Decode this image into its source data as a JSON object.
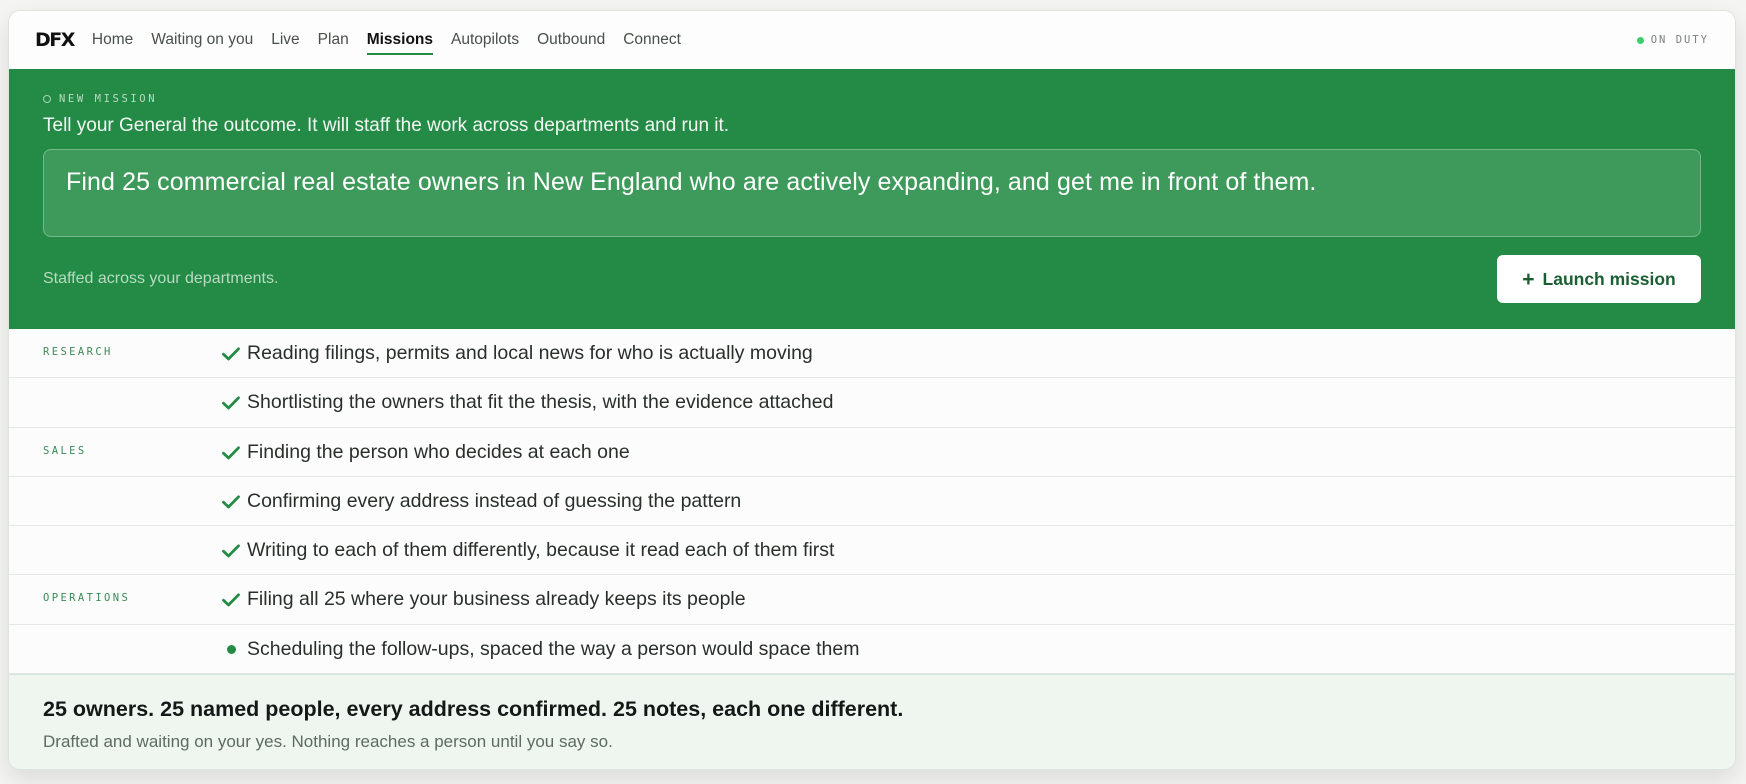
{
  "nav": {
    "logo": "DFX",
    "links": [
      "Home",
      "Waiting on you",
      "Live",
      "Plan",
      "Missions",
      "Autopilots",
      "Outbound",
      "Connect"
    ],
    "active": "Missions",
    "status": "ON DUTY"
  },
  "hero": {
    "eyebrow": "NEW MISSION",
    "subtitle": "Tell your General the outcome. It will staff the work across departments and run it.",
    "mission_text": "Find 25 commercial real estate owners in New England who are actively expanding, and get me in front of them.",
    "staffed": "Staffed across your departments.",
    "launch_label": "Launch mission"
  },
  "tasks": [
    {
      "dept": "RESEARCH",
      "text": "Reading filings, permits and local news for who is actually moving",
      "state": "done"
    },
    {
      "dept": "",
      "text": "Shortlisting the owners that fit the thesis, with the evidence attached",
      "state": "done"
    },
    {
      "dept": "SALES",
      "text": "Finding the person who decides at each one",
      "state": "done"
    },
    {
      "dept": "",
      "text": "Confirming every address instead of guessing the pattern",
      "state": "done"
    },
    {
      "dept": "",
      "text": "Writing to each of them differently, because it read each of them first",
      "state": "done"
    },
    {
      "dept": "OPERATIONS",
      "text": "Filing all 25 where your business already keeps its people",
      "state": "done"
    },
    {
      "dept": "",
      "text": "Scheduling the follow-ups, spaced the way a person would space them",
      "state": "in-progress"
    }
  ],
  "summary": {
    "title": "25 owners. 25 named people, every address confirmed. 25 notes, each one different.",
    "subtitle": "Drafted and waiting on your yes. Nothing reaches a person until you say so."
  },
  "colors": {
    "brand_green": "#238b45",
    "check_green": "#238b45",
    "status_dot": "#3ccf6a"
  }
}
